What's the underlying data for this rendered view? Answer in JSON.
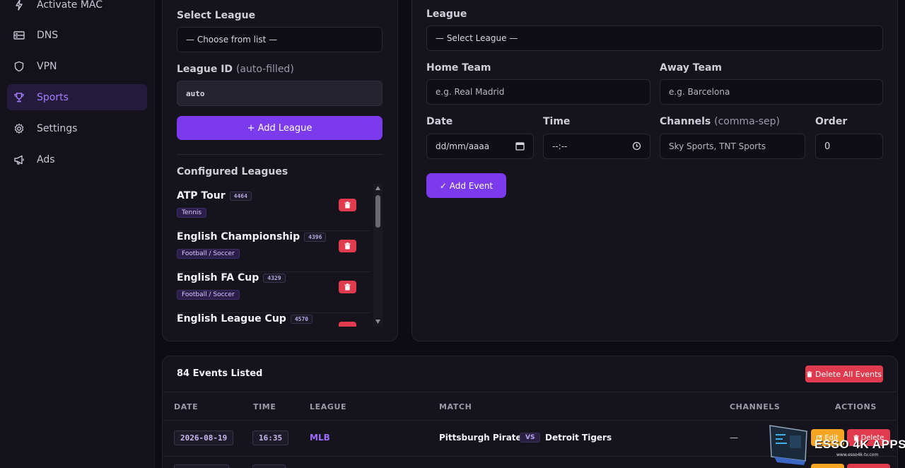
{
  "sidebar": {
    "items": [
      {
        "label": "Activate MAC",
        "icon": "bolt-icon"
      },
      {
        "label": "DNS",
        "icon": "server-icon"
      },
      {
        "label": "VPN",
        "icon": "shield-icon"
      },
      {
        "label": "Sports",
        "icon": "trophy-icon",
        "active": true
      },
      {
        "label": "Settings",
        "icon": "gear-icon"
      },
      {
        "label": "Ads",
        "icon": "megaphone-icon"
      }
    ]
  },
  "league_form": {
    "select_label": "Select League",
    "select_value": "— Choose from list —",
    "id_label": "League ID",
    "id_label_note": "(auto-filled)",
    "id_value": "auto",
    "add_button": "+ Add League",
    "configured_title": "Configured Leagues",
    "leagues": [
      {
        "name": "ATP Tour",
        "id": "4464",
        "sport": "Tennis"
      },
      {
        "name": "English Championship",
        "id": "4396",
        "sport": "Football / Soccer"
      },
      {
        "name": "English FA Cup",
        "id": "4329",
        "sport": "Football / Soccer"
      },
      {
        "name": "English League Cup",
        "id": "4570",
        "sport": ""
      }
    ]
  },
  "event_form": {
    "league_label": "League",
    "league_value": "— Select League —",
    "home_label": "Home Team",
    "home_placeholder": "e.g. Real Madrid",
    "away_label": "Away Team",
    "away_placeholder": "e.g. Barcelona",
    "date_label": "Date",
    "date_placeholder": "dd/mm/aaaa",
    "time_label": "Time",
    "time_placeholder": "--:--",
    "channels_label": "Channels",
    "channels_note": "(comma-sep)",
    "channels_placeholder": "Sky Sports, TNT Sports",
    "order_label": "Order",
    "order_value": "0",
    "add_button": "✓ Add Event"
  },
  "events": {
    "count_title": "84 Events Listed",
    "delete_all": "Delete All Events",
    "headers": {
      "date": "DATE",
      "time": "TIME",
      "league": "LEAGUE",
      "match": "MATCH",
      "channels": "CHANNELS",
      "actions": "ACTIONS"
    },
    "rows": [
      {
        "date": "2026-08-19",
        "time": "16:35",
        "league": "MLB",
        "home": "Pittsburgh Pirates",
        "vs": "VS",
        "away": "Detroit Tigers",
        "channels": "—",
        "edit": "Edit",
        "delete": "Delete"
      }
    ]
  },
  "watermark": {
    "brand": "ESSO 4K APPS",
    "url": "www.esso4k-tv.com"
  },
  "colors": {
    "accent": "#7c3aed",
    "danger": "#e03a4e",
    "warning": "#f5a524"
  }
}
